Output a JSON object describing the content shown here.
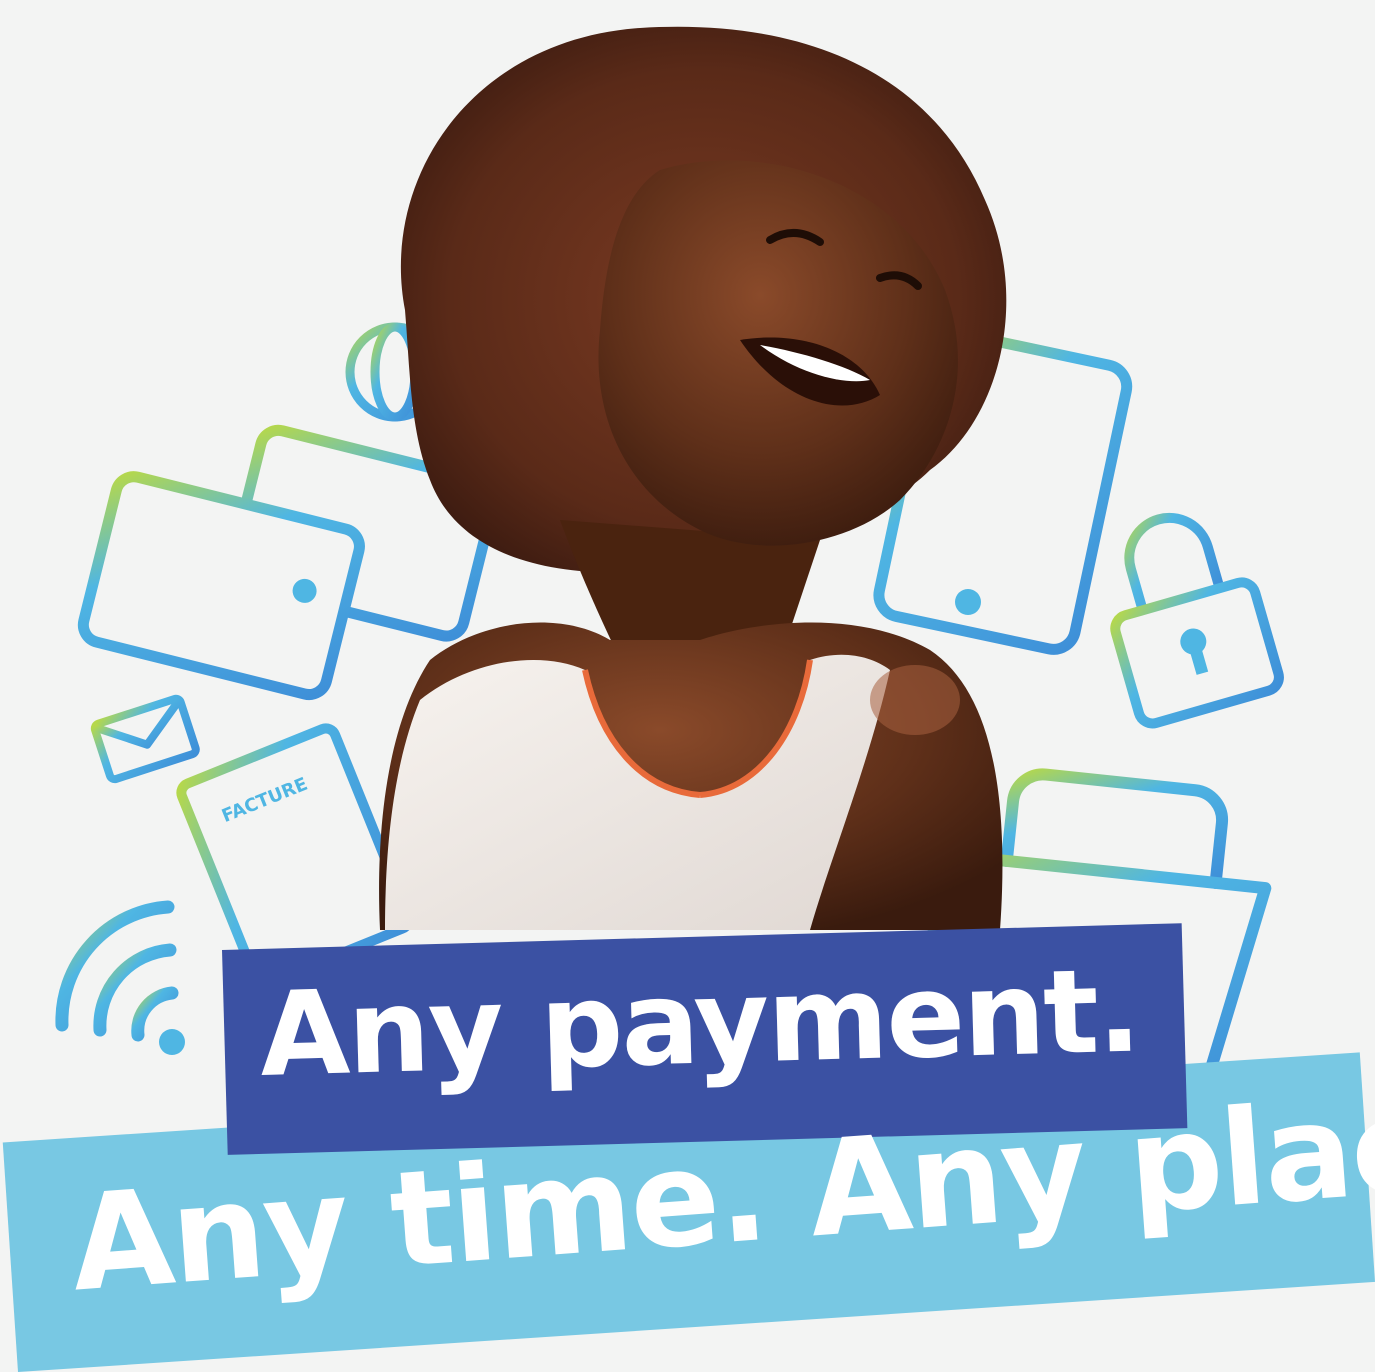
{
  "ad": {
    "headline": "Any payment.",
    "subline": "Any time. Any place.",
    "invoice_label": "FACTURE"
  },
  "icons": [
    "globe-icon",
    "credit-card-icon",
    "tablet-icon",
    "padlock-icon",
    "envelope-icon",
    "invoice-icon",
    "wifi-icon",
    "shopping-basket-icon"
  ],
  "colors": {
    "background": "#f3f4f3",
    "icon_stroke": "#4fb6e3",
    "icon_accent": "#b6d84a",
    "headline_band": "#3b51a3",
    "subline_band": "#78c8e3",
    "text": "#ffffff"
  }
}
